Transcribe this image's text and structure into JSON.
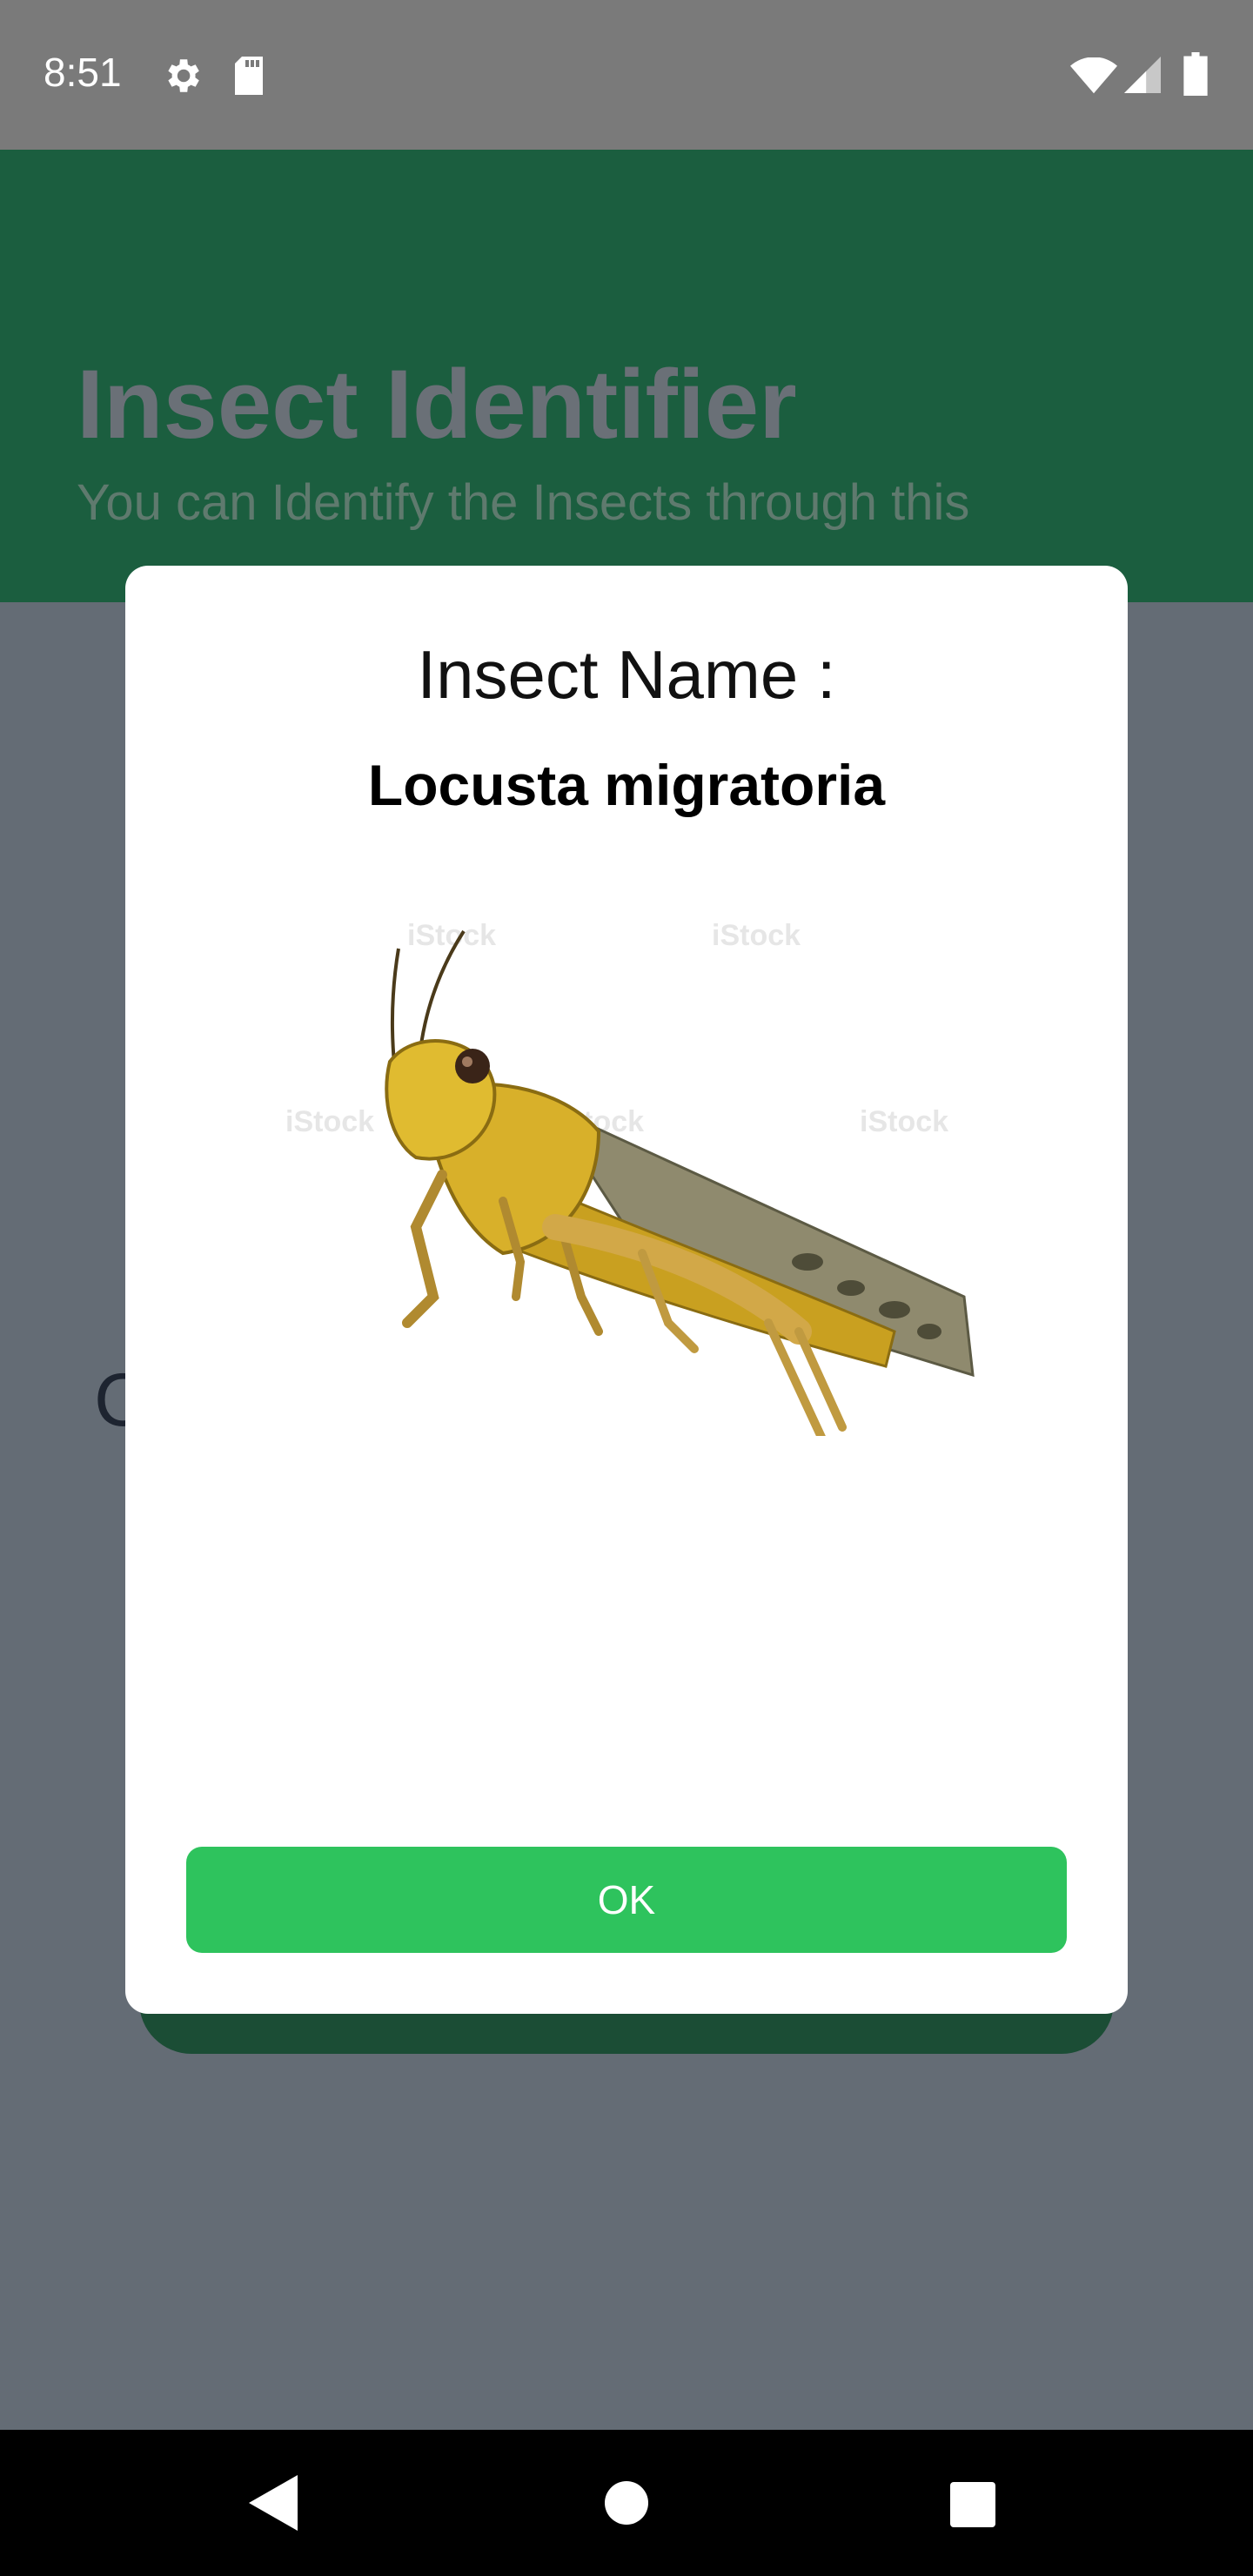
{
  "status_bar": {
    "time": "8:51",
    "icons": [
      "settings-gear-icon",
      "sd-card-icon",
      "wifi-icon",
      "cellular-signal-icon",
      "battery-icon"
    ]
  },
  "header": {
    "title": "Insect Identifier",
    "subtitle": "You can Identify the Insects through this"
  },
  "background": {
    "peek_text": "C"
  },
  "dialog": {
    "title": "Insect Name :",
    "insect_name": "Locusta migratoria",
    "image_subject": "locust-image",
    "ok_label": "OK"
  },
  "nav_bar": {
    "buttons": [
      "back-icon",
      "home-icon",
      "recents-icon"
    ]
  },
  "colors": {
    "header_bg": "#1b5e3f",
    "scrim": "#646c75",
    "ok_button": "#2ec35d",
    "status_bar": "#7a7a7a"
  }
}
